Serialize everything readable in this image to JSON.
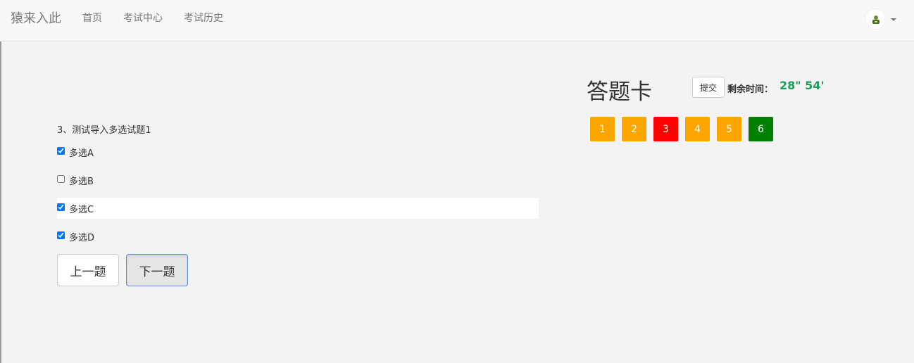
{
  "navbar": {
    "brand": "猿来入此",
    "links": [
      "首页",
      "考试中心",
      "考试历史"
    ]
  },
  "question": {
    "title": "3、测试导入多选试题1",
    "options": [
      {
        "label": "多选A",
        "checked": true
      },
      {
        "label": "多选B",
        "checked": false
      },
      {
        "label": "多选C",
        "checked": true
      },
      {
        "label": "多选D",
        "checked": true
      }
    ],
    "prev_label": "上一题",
    "next_label": "下一题"
  },
  "answer_card": {
    "title": "答题卡",
    "submit_label": "提交",
    "time_label": "剩余时间：",
    "time_value": "28\" 54'",
    "numbers": [
      {
        "num": "1",
        "color": "#ffa500"
      },
      {
        "num": "2",
        "color": "#ffa500"
      },
      {
        "num": "3",
        "color": "#ff0000"
      },
      {
        "num": "4",
        "color": "#ffa500"
      },
      {
        "num": "5",
        "color": "#ffa500"
      },
      {
        "num": "6",
        "color": "#008000"
      }
    ]
  },
  "colors": {
    "time_green": "#1e9c5a",
    "answered": "#ffa500",
    "current": "#ff0000",
    "done": "#008000"
  }
}
